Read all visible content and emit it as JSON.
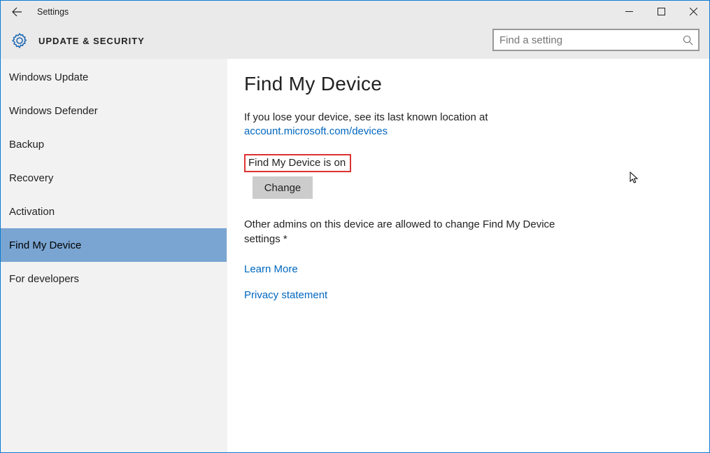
{
  "window": {
    "title": "Settings"
  },
  "header": {
    "heading": "UPDATE & SECURITY"
  },
  "search": {
    "placeholder": "Find a setting"
  },
  "sidebar": {
    "items": [
      {
        "label": "Windows Update",
        "selected": false
      },
      {
        "label": "Windows Defender",
        "selected": false
      },
      {
        "label": "Backup",
        "selected": false
      },
      {
        "label": "Recovery",
        "selected": false
      },
      {
        "label": "Activation",
        "selected": false
      },
      {
        "label": "Find My Device",
        "selected": true
      },
      {
        "label": "For developers",
        "selected": false
      }
    ]
  },
  "content": {
    "title": "Find My Device",
    "description_prefix": "If you lose your device, see its last known location at",
    "description_link": "account.microsoft.com/devices",
    "status_text": "Find My Device is on",
    "change_button": "Change",
    "other_admins": "Other admins on this device are allowed to change Find My Device settings *",
    "learn_more": "Learn More",
    "privacy_statement": "Privacy statement"
  }
}
